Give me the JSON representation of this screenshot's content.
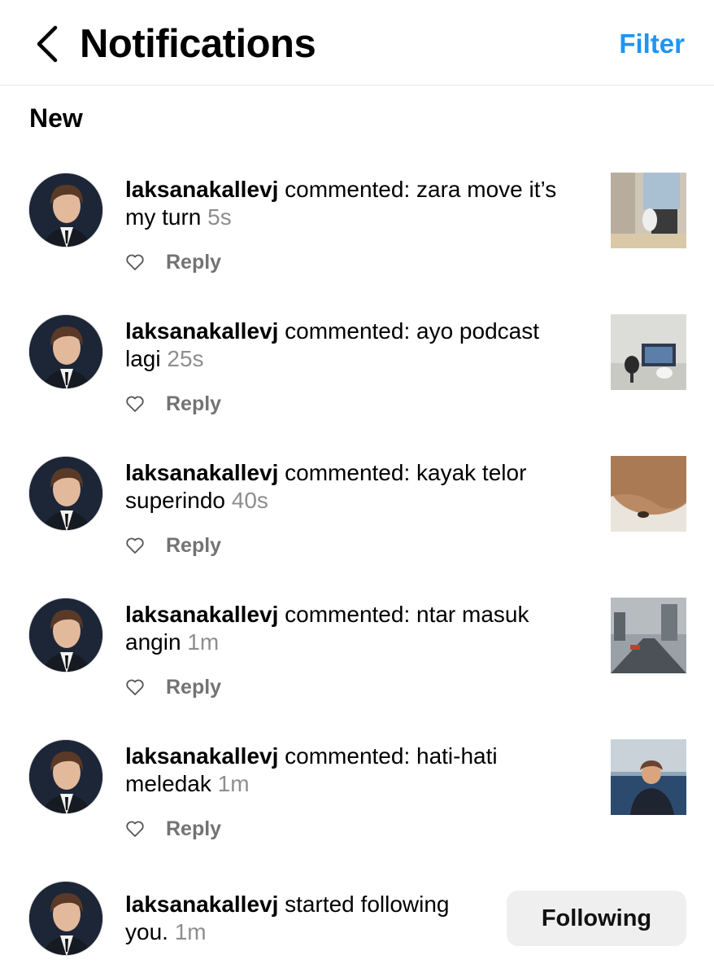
{
  "header": {
    "title": "Notifications",
    "filter_label": "Filter"
  },
  "section_label": "New",
  "notifications": [
    {
      "username": "laksanakallevj",
      "text": "commented: zara move it’s my turn",
      "time": "5s",
      "reply_label": "Reply",
      "thumb": "kid-with-toy"
    },
    {
      "username": "laksanakallevj",
      "text": "commented: ayo podcast lagi",
      "time": "25s",
      "reply_label": "Reply",
      "thumb": "podcast-setup"
    },
    {
      "username": "laksanakallevj",
      "text": "commented: kayak telor superindo",
      "time": "40s",
      "reply_label": "Reply",
      "thumb": "hair-closeup"
    },
    {
      "username": "laksanakallevj",
      "text": "commented: ntar masuk angin",
      "time": "1m",
      "reply_label": "Reply",
      "thumb": "snowy-street"
    },
    {
      "username": "laksanakallevj",
      "text": "commented: hati-hati meledak",
      "time": "1m",
      "reply_label": "Reply",
      "thumb": "person-indoors"
    }
  ],
  "follow": {
    "username": "laksanakallevj",
    "text": "started following you.",
    "time": "1m",
    "button_label": "Following"
  }
}
